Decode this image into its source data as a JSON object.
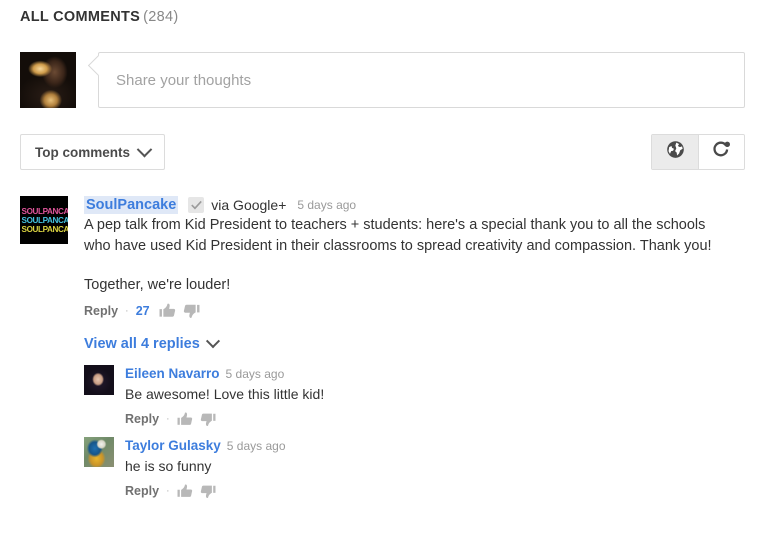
{
  "header": {
    "title": "ALL COMMENTS",
    "count": "(284)"
  },
  "composer": {
    "placeholder": "Share your thoughts",
    "value": "",
    "avatar_icon": "user-photo-avatar"
  },
  "toolbar": {
    "sort_label": "Top comments",
    "sort_chevron_icon": "chevron-down-icon",
    "view_toggles": [
      {
        "name": "public-view",
        "icon": "globe-icon",
        "active": true
      },
      {
        "name": "circles-view",
        "icon": "google-plus-circles-icon",
        "active": false
      }
    ]
  },
  "comments": [
    {
      "author": "SoulPancake",
      "avatar_icon": "soulpancake-logo-avatar",
      "avatar_text": [
        "SOULPANCAKE",
        "SOULPANCAKE",
        "SOULPANCAKE"
      ],
      "verified_icon": "verified-check-icon",
      "via": "via Google+",
      "time": "5 days ago",
      "paragraphs": [
        "A pep talk from Kid President to teachers + students: here's a special thank you to all the schools who have used Kid President in their classrooms to spread creativity and compassion. Thank you!",
        "Together, we're louder!"
      ],
      "reply_label": "Reply",
      "separator": "·",
      "vote_count": "27",
      "thumbs_up_icon": "thumbs-up-icon",
      "thumbs_down_icon": "thumbs-down-icon",
      "view_replies_label": "View all 4 replies",
      "view_replies_chevron_icon": "chevron-down-icon",
      "replies": [
        {
          "author": "Eileen Navarro",
          "avatar_icon": "eileen-navarro-avatar",
          "time": "5 days ago",
          "text": "Be awesome! Love this little kid!",
          "reply_label": "Reply",
          "separator": "·",
          "thumbs_up_icon": "thumbs-up-icon",
          "thumbs_down_icon": "thumbs-down-icon"
        },
        {
          "author": "Taylor Gulasky",
          "avatar_icon": "taylor-gulasky-parrot-avatar",
          "time": "5 days ago",
          "text": "he is so funny",
          "reply_label": "Reply",
          "separator": "·",
          "thumbs_up_icon": "thumbs-up-icon",
          "thumbs_down_icon": "thumbs-down-icon"
        }
      ]
    }
  ],
  "colors": {
    "link_blue": "#3d7ddd",
    "text": "#333333",
    "muted": "#9a9a9a",
    "border": "#dcdcdc",
    "toggle_active_bg": "#ebebeb"
  }
}
